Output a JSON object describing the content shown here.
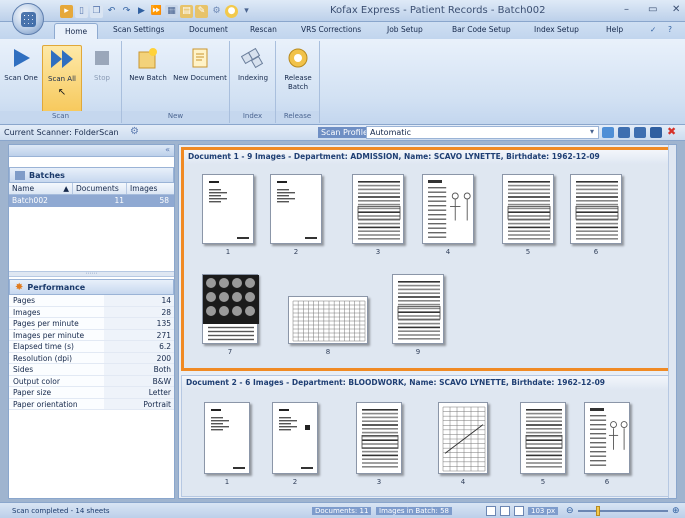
{
  "window": {
    "title": "Kofax Express - Patient Records - Batch002",
    "minimize": "–",
    "maximize": "▭",
    "close": "✕"
  },
  "tabs": [
    {
      "label": "Home",
      "active": true
    },
    {
      "label": "Scan Settings"
    },
    {
      "label": "Document"
    },
    {
      "label": "Rescan"
    },
    {
      "label": "VRS Corrections"
    },
    {
      "label": "Job Setup"
    },
    {
      "label": "Bar Code Setup"
    },
    {
      "label": "Index Setup"
    },
    {
      "label": "Help"
    }
  ],
  "ribbon": {
    "groups": {
      "scan": "Scan",
      "new": "New",
      "index": "Index",
      "release": "Release"
    },
    "buttons": {
      "scan_one": "Scan One",
      "scan_all": "Scan All",
      "stop": "Stop",
      "new_batch": "New Batch",
      "new_document": "New Document",
      "indexing": "Indexing",
      "release_batch_1": "Release",
      "release_batch_2": "Batch"
    }
  },
  "scanner": {
    "current": "Current Scanner: FolderScan",
    "profile_label": "Scan Profile",
    "profile_value": "Automatic"
  },
  "batches": {
    "title": "Batches",
    "columns": [
      "Name",
      "Documents",
      "Images"
    ],
    "rows": [
      {
        "name": "Batch002",
        "documents": "11",
        "images": "58"
      }
    ]
  },
  "performance": {
    "title": "Performance",
    "rows": [
      {
        "k": "Pages",
        "v": "14"
      },
      {
        "k": "Images",
        "v": "28"
      },
      {
        "k": "Pages per minute (ppm)",
        "v": "135"
      },
      {
        "k": "Images per minute (ipm)",
        "v": "271"
      },
      {
        "k": "Elapsed time (s)",
        "v": "6.2"
      },
      {
        "k": "Resolution (dpi)",
        "v": "200"
      },
      {
        "k": "Sides",
        "v": "Both"
      },
      {
        "k": "Output color",
        "v": "B&W"
      },
      {
        "k": "Paper size",
        "v": "Letter"
      },
      {
        "k": "Paper orientation",
        "v": "Portrait"
      }
    ]
  },
  "documents": [
    {
      "header": "Document 1 - 9 Images - Department: ADMISSION, Name: SCAVO LYNETTE, Birthdate: 1962-12-09",
      "pages": [
        "1",
        "2",
        "3",
        "4",
        "5",
        "6",
        "7",
        "8",
        "9"
      ]
    },
    {
      "header": "Document 2 - 6 Images - Department: BLOODWORK, Name: SCAVO LYNETTE, Birthdate: 1962-12-09",
      "pages": [
        "1",
        "2",
        "3",
        "4",
        "5",
        "6"
      ]
    }
  ],
  "status": {
    "left": "Scan completed - 14 sheets",
    "documents": "Documents: 11",
    "images": "Images in Batch: 58",
    "zoom": "103 px"
  },
  "colors": {
    "selected_border": "#f08a24",
    "accent_blue": "#2f5fa0"
  }
}
